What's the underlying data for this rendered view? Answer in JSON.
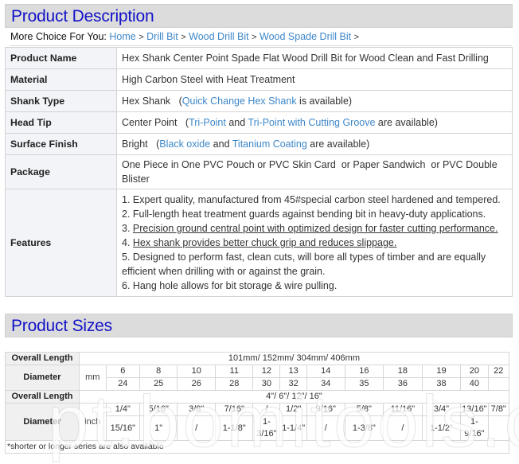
{
  "description_section": {
    "title": "Product Description",
    "breadcrumb": {
      "lead": "More Choice For You:",
      "links": [
        "Home",
        "Drill Bit",
        "Wood Drill Bit",
        "Wood Spade Drill Bit"
      ],
      "separator": ">"
    },
    "rows": [
      {
        "label": "Product Name",
        "value": "Hex Shank Center Point Spade Flat Wood Drill Bit for Wood Clean and Fast Drilling"
      },
      {
        "label": "Material",
        "value": "High Carbon Steel with Heat Treatment"
      },
      {
        "label": "Shank Type",
        "prefix": "Hex Shank   (",
        "link1": "Quick Change Hex Shank",
        "suffix": " is available)"
      },
      {
        "label": "Head Tip",
        "prefix": "Center Point   (",
        "link1": "Tri-Point",
        "middle": " and ",
        "link2": "Tri-Point with Cutting Groove",
        "suffix": " are available)"
      },
      {
        "label": "Surface Finish",
        "prefix": "Bright   (",
        "link1": "Black oxide",
        "middle": " and ",
        "link2": "Titanium Coating",
        "suffix": " are available)"
      },
      {
        "label": "Package",
        "value": "One Piece in One PVC Pouch or PVC Skin Card  or Paper Sandwich  or PVC Double Blister"
      },
      {
        "label": "Features",
        "features": [
          {
            "num": "1. ",
            "text": "Expert quality, manufactured from 45#special carbon steel hardened and tempered."
          },
          {
            "num": "2. ",
            "text": "Full-length heat treatment guards against bending bit in heavy-duty applications."
          },
          {
            "num": "3. ",
            "text": "Precision ground central point with optimized design for faster cutting performance."
          },
          {
            "num": "4. ",
            "text": "Hex shank provides better chuck grip and reduces slippage."
          },
          {
            "num": "5. ",
            "text": "Designed to perform fast, clean cuts, will bore all types of timber and are equally efficient when drilling with or against the grain."
          },
          {
            "num": "6. ",
            "text": "Hang hole allows for bit storage & wire pulling."
          }
        ]
      }
    ]
  },
  "sizes_section": {
    "title": "Product Sizes",
    "metric": {
      "overall_length_label": "Overall Length",
      "overall_length_value": "101mm/ 152mm/ 304mm/ 406mm",
      "diameter_label": "Diameter",
      "unit": "mm",
      "row1": [
        "6",
        "8",
        "10",
        "11",
        "12",
        "13",
        "14",
        "16",
        "18",
        "19",
        "20",
        "22"
      ],
      "row2": [
        "24",
        "25",
        "26",
        "28",
        "30",
        "32",
        "34",
        "35",
        "36",
        "38",
        "40",
        ""
      ]
    },
    "imperial": {
      "overall_length_label": "Overall Length",
      "overall_length_value": "4\"/ 6\"/ 12\"/ 16\"",
      "diameter_label": "Diameter",
      "unit": "inch",
      "row1": [
        "1/4\"",
        "5/16\"",
        "3/8\"",
        "7/16\"",
        "/",
        "1/2\"",
        "9/16\"",
        "5/8\"",
        "11/16\"",
        "3/4\"",
        "13/16\"",
        "7/8\""
      ],
      "row2": [
        "15/16\"",
        "1\"",
        "/",
        "1-1/8\"",
        "1-3/16\"",
        "1-1/4\"",
        "/",
        "1-3/8\"",
        "/",
        "1-1/2\"",
        "1-9/16\"",
        ""
      ]
    },
    "note": "*shorter or longer series are also available"
  },
  "watermark": "pt.bomitools.com",
  "colors": {
    "header_text": "#1212c8",
    "header_bg": "#dcdcdc",
    "link": "#3d87c8"
  }
}
